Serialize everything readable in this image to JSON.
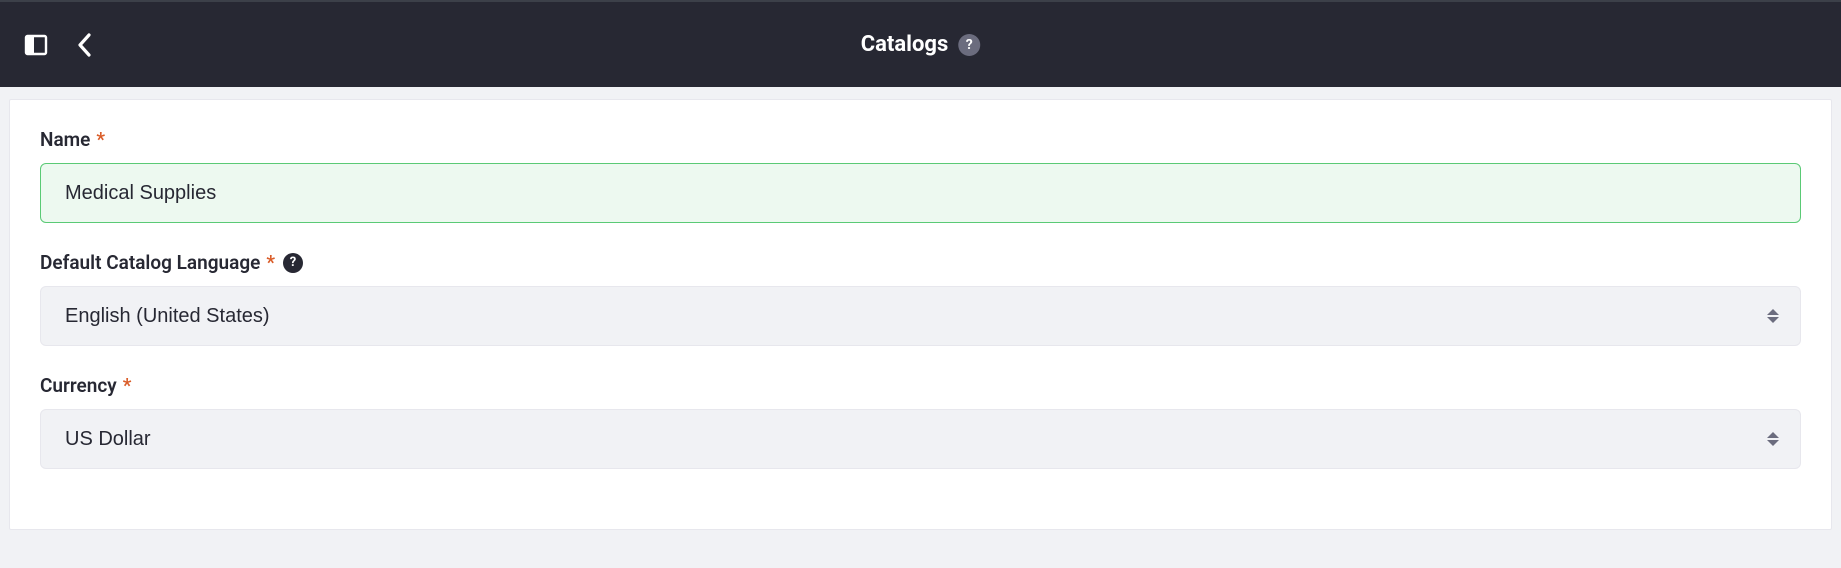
{
  "header": {
    "title": "Catalogs",
    "help_symbol": "?"
  },
  "form": {
    "name": {
      "label": "Name",
      "required_mark": "*",
      "value": "Medical Supplies"
    },
    "language": {
      "label": "Default Catalog Language",
      "required_mark": "*",
      "help_symbol": "?",
      "value": "English (United States)"
    },
    "currency": {
      "label": "Currency",
      "required_mark": "*",
      "value": "US Dollar"
    }
  }
}
